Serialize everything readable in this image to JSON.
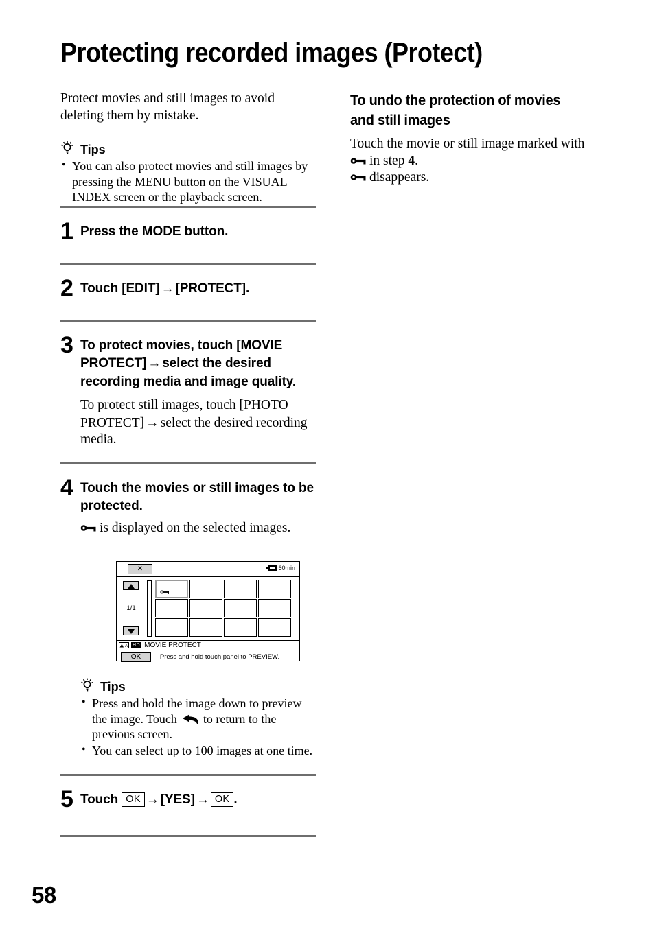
{
  "title": "Protecting recorded images (Protect)",
  "page_number": "58",
  "left_column": {
    "intro": "Protect movies and still images to avoid deleting them by mistake.",
    "tips_top": {
      "label": "Tips",
      "items": [
        "You can also protect movies and still images by pressing the MENU button on the VISUAL INDEX screen or the playback screen."
      ]
    },
    "steps": [
      {
        "number": "1",
        "title": "Press the MODE button."
      },
      {
        "number": "2",
        "title_parts": {
          "before": "Touch [EDIT]",
          "arrow": "→",
          "after": "[PROTECT]."
        }
      },
      {
        "number": "3",
        "title_parts": {
          "before": "To protect movies, touch [MOVIE PROTECT]",
          "arrow": "→",
          "after": "select the desired recording media and image quality."
        },
        "sub_parts": {
          "before": "To protect still images, touch [PHOTO PROTECT]",
          "arrow": "→",
          "after": "select the desired recording media."
        }
      },
      {
        "number": "4",
        "title": "Touch the movies or still images to be protected.",
        "sub_after_icon": "is displayed on the selected images."
      },
      {
        "number": "5",
        "title_parts": {
          "touch": "Touch",
          "ok1": "OK",
          "arrow1": "→",
          "yes": "[YES]",
          "arrow2": "→",
          "ok2": "OK",
          "period": "."
        }
      }
    ],
    "lcd": {
      "close_label": "✕",
      "battery_text": "60min",
      "page_indicator": "1/1",
      "quality_badge": "HD",
      "status_label": "MOVIE PROTECT",
      "ok_label": "OK",
      "hint_text": "Press and hold touch panel to PREVIEW."
    },
    "tips_bottom": {
      "label": "Tips",
      "item1_before_icon": "Press and hold the image down to preview the image. Touch",
      "item1_after_icon": "to return to the previous screen.",
      "item2": "You can select up to 100 images at one time."
    }
  },
  "right_column": {
    "heading": "To undo the protection of movies and still images",
    "line1": "Touch the movie or still image marked with",
    "line2_middle": "in step",
    "line2_step": "4",
    "line2_end": ".",
    "line3": "disappears."
  }
}
